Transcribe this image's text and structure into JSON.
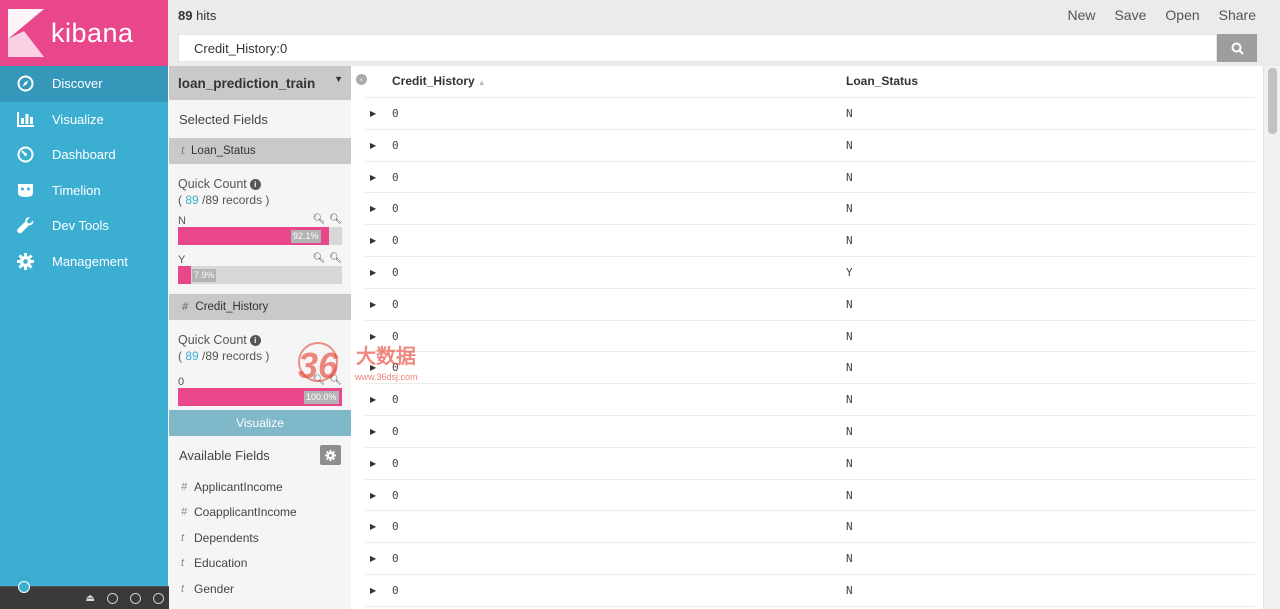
{
  "brand": {
    "name": "kibana",
    "logo_color": "#e8488b",
    "nav_color": "#3caed2"
  },
  "nav": {
    "items": [
      {
        "label": "Discover",
        "icon": "compass-icon"
      },
      {
        "label": "Visualize",
        "icon": "bar-chart-icon"
      },
      {
        "label": "Dashboard",
        "icon": "dashboard-icon"
      },
      {
        "label": "Timelion",
        "icon": "timelion-icon"
      },
      {
        "label": "Dev Tools",
        "icon": "wrench-icon"
      },
      {
        "label": "Management",
        "icon": "gear-icon"
      }
    ]
  },
  "header": {
    "hits_count": "89",
    "hits_label": "hits",
    "menu": {
      "new": "New",
      "save": "Save",
      "open": "Open",
      "share": "Share"
    },
    "query": "Credit_History:0"
  },
  "sidebar": {
    "index_pattern": "loan_prediction_train",
    "selected_title": "Selected Fields",
    "selected": [
      {
        "type": "t",
        "name": "Loan_Status",
        "quick_count_label": "Quick Count",
        "records_open": "(",
        "records_count": "89",
        "records_rest": "/89 records )",
        "values": [
          {
            "label": "N",
            "percent_text": "92.1%",
            "fraction": 0.921
          },
          {
            "label": "Y",
            "percent_text": "7.9%",
            "fraction": 0.079
          }
        ]
      },
      {
        "type": "#",
        "name": "Credit_History",
        "quick_count_label": "Quick Count",
        "records_open": "(",
        "records_count": "89",
        "records_rest": "/89 records )",
        "values": [
          {
            "label": "0",
            "percent_text": "100.0%",
            "fraction": 1.0
          }
        ]
      }
    ],
    "visualize_label": "Visualize",
    "available_title": "Available Fields",
    "available": [
      {
        "type": "#",
        "name": "ApplicantIncome"
      },
      {
        "type": "#",
        "name": "CoapplicantIncome"
      },
      {
        "type": "t",
        "name": "Dependents"
      },
      {
        "type": "t",
        "name": "Education"
      },
      {
        "type": "t",
        "name": "Gender"
      }
    ]
  },
  "table": {
    "columns": [
      "Credit_History",
      "Loan_Status"
    ],
    "rows": [
      [
        "0",
        "N"
      ],
      [
        "0",
        "N"
      ],
      [
        "0",
        "N"
      ],
      [
        "0",
        "N"
      ],
      [
        "0",
        "N"
      ],
      [
        "0",
        "Y"
      ],
      [
        "0",
        "N"
      ],
      [
        "0",
        "N"
      ],
      [
        "0",
        "N"
      ],
      [
        "0",
        "N"
      ],
      [
        "0",
        "N"
      ],
      [
        "0",
        "N"
      ],
      [
        "0",
        "N"
      ],
      [
        "0",
        "N"
      ],
      [
        "0",
        "N"
      ],
      [
        "0",
        "N"
      ]
    ]
  },
  "watermark": {
    "number": "36",
    "cn": "大数据",
    "url": "www.36dsj.com"
  }
}
